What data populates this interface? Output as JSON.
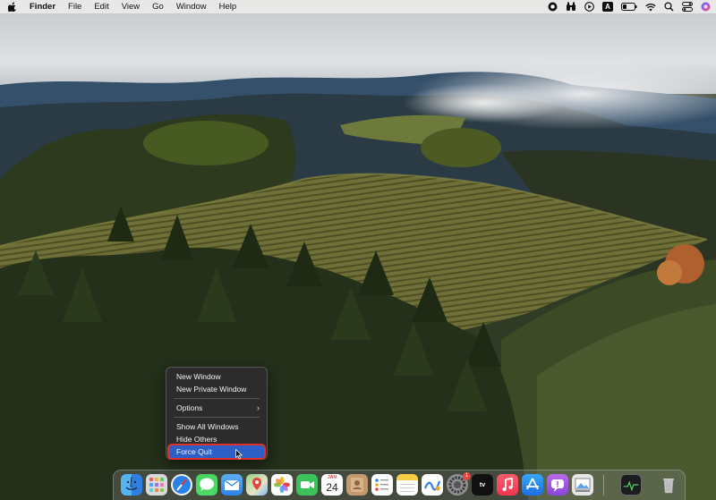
{
  "menubar": {
    "app_name": "Finder",
    "items": [
      "File",
      "Edit",
      "View",
      "Go",
      "Window",
      "Help"
    ],
    "status_icons": [
      "record-icon",
      "binoculars-icon",
      "play-icon",
      "text-input-icon",
      "battery-icon",
      "wifi-icon",
      "search-icon",
      "control-center-icon",
      "siri-icon"
    ],
    "input_source_label": "A"
  },
  "context_menu": {
    "items": [
      {
        "label": "New Window"
      },
      {
        "label": "New Private Window"
      },
      {
        "label": "Options",
        "submenu": true
      },
      {
        "label": "Show All Windows"
      },
      {
        "label": "Hide Others"
      },
      {
        "label": "Force Quit",
        "highlighted": true
      }
    ]
  },
  "dock": {
    "apps": [
      "finder",
      "launchpad",
      "safari",
      "messages",
      "mail",
      "maps",
      "photos",
      "facetime",
      "calendar",
      "contacts",
      "reminders",
      "notes",
      "freeform",
      "system-settings",
      "tv",
      "music",
      "app-store",
      "feedback-assistant",
      "preview",
      "activity-monitor",
      "trash"
    ],
    "calendar_month": "JAN",
    "calendar_day": "24",
    "tv_label": "tv",
    "system_settings_badge": "1",
    "colors": {
      "selection": "#2d5fc6",
      "annotation_outline": "#e0322c"
    }
  }
}
